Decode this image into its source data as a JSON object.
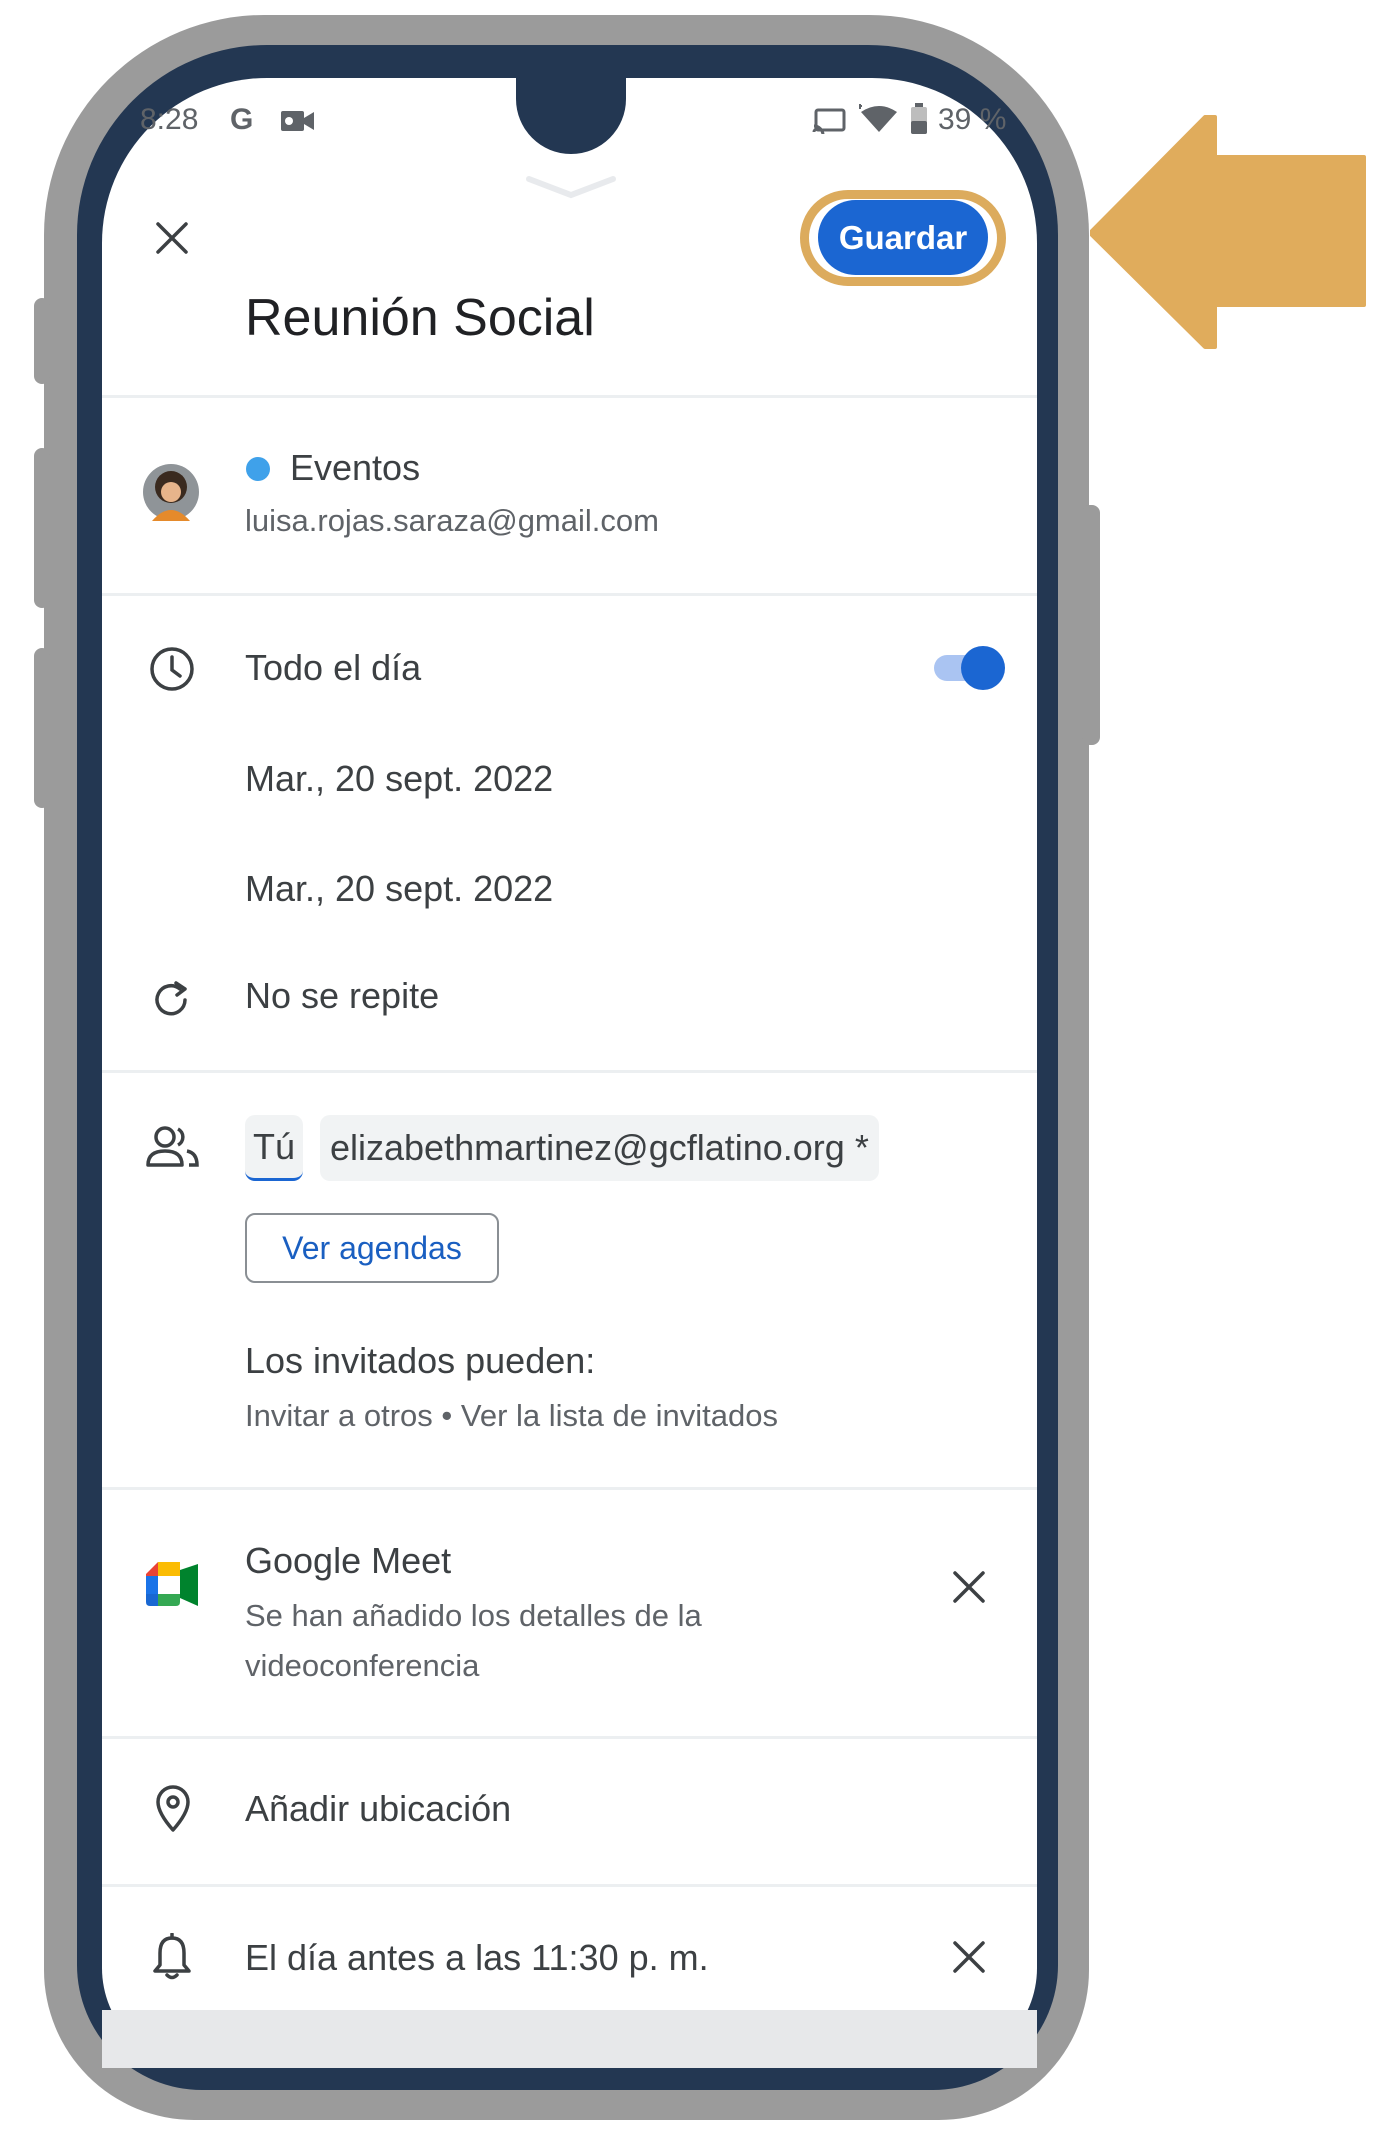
{
  "status_bar": {
    "time": "8:28",
    "g_label": "G",
    "battery": "39 %"
  },
  "header": {
    "save_label": "Guardar",
    "title": "Reunión Social"
  },
  "calendar": {
    "name": "Eventos",
    "account": "luisa.rojas.saraza@gmail.com",
    "color": "#3fa1ea"
  },
  "schedule": {
    "all_day_label": "Todo el día",
    "all_day_on": true,
    "start_date": "Mar., 20 sept. 2022",
    "end_date": "Mar., 20 sept. 2022",
    "repeat": "No se repite"
  },
  "guests": {
    "you_chip": "Tú",
    "email_chip": "elizabethmartinez@gcflatino.org *",
    "view_schedules": "Ver agendas",
    "permissions_title": "Los invitados pueden:",
    "permissions_detail": "Invitar a otros • Ver la lista de invitados"
  },
  "meet": {
    "title": "Google Meet",
    "detail_line1": "Se han añadido los detalles de la",
    "detail_line2": "videoconferencia"
  },
  "location": {
    "placeholder": "Añadir ubicación"
  },
  "notification": {
    "text": "El día antes a las 11:30 p. m."
  },
  "colors": {
    "accent_blue": "#1b66d2",
    "arrow": "#e0ac5c",
    "frame": "#233752"
  }
}
